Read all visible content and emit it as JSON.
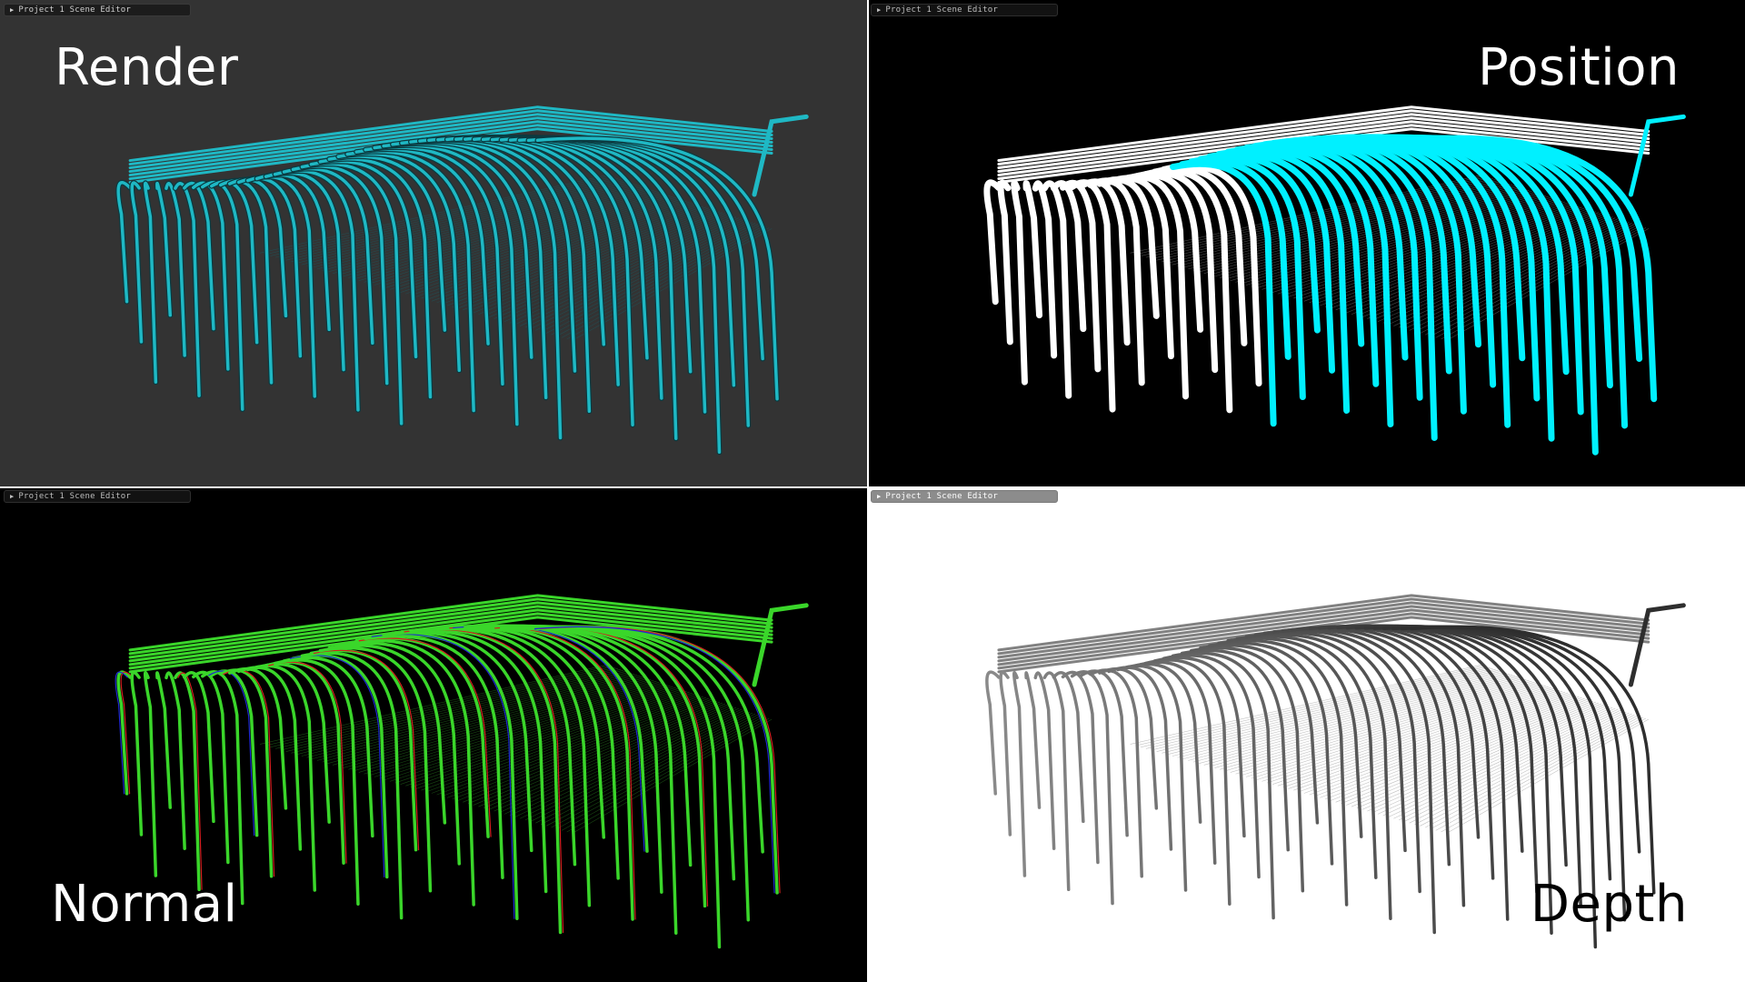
{
  "panels": [
    {
      "id": "render",
      "window_title": "Project 1 Scene Editor",
      "caption": "Render",
      "background": "#333333",
      "pipe_color": "#1fb8c4",
      "pipe_shadow": "#0b3a40"
    },
    {
      "id": "position",
      "window_title": "Project 1 Scene Editor",
      "caption": "Position",
      "background": "#000000",
      "pipe_color": "#ffffff",
      "pipe_color_secondary": "#00f0ff"
    },
    {
      "id": "normal",
      "window_title": "Project 1 Scene Editor",
      "caption": "Normal",
      "background": "#000000",
      "pipe_color": "#3ad62a",
      "pipe_accent_red": "#d21e1e",
      "pipe_accent_blue": "#1e2ad2"
    },
    {
      "id": "depth",
      "window_title": "Project 1 Scene Editor",
      "caption": "Depth",
      "background": "#ffffff",
      "pipe_color": "#2e2e2e",
      "pipe_color_far": "#8a8a8a"
    }
  ],
  "icons": {
    "collapse": "triangle-right-icon"
  }
}
